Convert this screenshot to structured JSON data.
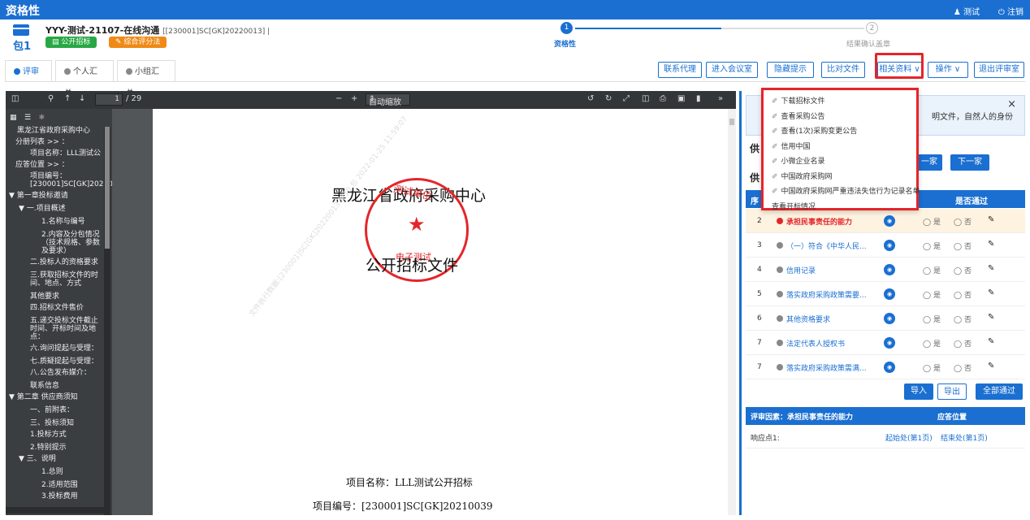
{
  "topbar": {
    "title": "资格性",
    "user": "测试",
    "logout": "注销"
  },
  "header": {
    "package_label": "包1",
    "project_name": "YYY-测试-21107-在线沟通",
    "project_code": "[230001]SC[GK]20220013",
    "tag_public": "公开招标",
    "tag_method": "综合评分法",
    "step1_num": "1",
    "step1_label": "资格性",
    "step2_num": "2",
    "step2_label": "结果确认盖章"
  },
  "tabs": [
    {
      "label": "评审"
    },
    {
      "label": "个人汇总"
    },
    {
      "label": "小组汇总"
    }
  ],
  "toolbar": {
    "contact_agent": "联系代理",
    "enter_meeting": "进入会议室",
    "hide_tip": "隐藏提示",
    "compare_files": "比对文件",
    "related_docs": "相关资料 ∨",
    "operation": "操作 ∨",
    "exit_review": "退出评审室"
  },
  "pdf": {
    "page_input": "1",
    "page_total": "/ 29",
    "zoom": "自动缩放",
    "title_line1": "黑龙江省政府采购中心",
    "title_line2": "公开招标文件",
    "seal_top": "测试单位",
    "seal_bottom": "电子测试",
    "project_name_line": "项目名称：LLL测试公开招标",
    "project_code_line": "项目编号：[230001]SC[GK]20210039",
    "watermark": "文件执行数据:[230001]SC[GK]20220013 第10 包 2022-01-25 11:59:07"
  },
  "outline": [
    "黑龙江省政府采购中心",
    "分册列表 >> ：",
    "项目名称：LLL测试公",
    "应答位置 >> ：",
    "项目编号：",
    "[230001]SC[GK]202100",
    "▼ 第一章投标邀请",
    "▼ 一.项目概述",
    "1.名称与编号",
    "2.内容及分包情况",
    "（技术规格、参数",
    "及要求）",
    "二.投标人的资格要求",
    "三.获取招标文件的时",
    "间、地点、方式",
    "其他要求",
    "四.招标文件售价",
    "五.递交投标文件截止",
    "时间、开标时间及地",
    "点：",
    "六.询问提起与受理：",
    "七.质疑提起与受理：",
    "八.公告发布媒介：",
    "联系信息",
    "▼ 第二章 供应商须知",
    "一、前附表：",
    "三、投标须知",
    "1.投标方式",
    "2.特别提示",
    "▼ 三、说明",
    "1.总则",
    "2.适用范围",
    "3.投标费用"
  ],
  "dropdown": [
    "下载招标文件",
    "查看采购公告",
    "查看(1次)采购变更公告",
    "信用中国",
    "小微企业名录",
    "中国政府采购网",
    "中国政府采购网严重违法失信行为记录名单",
    "查看开标情况"
  ],
  "infobox": {
    "close": "×",
    "text": "明文件，自然人的身份"
  },
  "nav": {
    "prev": "一家",
    "next": "下一家",
    "side1": "供",
    "side2": "供"
  },
  "table": {
    "header_left": "序",
    "header_pass": "是否通过",
    "yes": "是",
    "no": "否",
    "rows": [
      {
        "num": "2",
        "name": "承担民事责任的能力"
      },
      {
        "num": "3",
        "name": "（一）符合《中华人民..."
      },
      {
        "num": "4",
        "name": "信用记录"
      },
      {
        "num": "5",
        "name": "落实政府采购政策需要..."
      },
      {
        "num": "6",
        "name": "其他资格要求"
      },
      {
        "num": "7",
        "name": "法定代表人授权书"
      },
      {
        "num": "7",
        "name": "落实政府采购政策需满..."
      }
    ]
  },
  "actions": {
    "import": "导入",
    "export": "导出",
    "pass_all": "全部通过"
  },
  "factor": {
    "label": "评审因素：承担民事责任的能力",
    "position_header": "应答位置",
    "response_point": "响应点1:",
    "start": "起始处(第1页)",
    "end": "结束处(第1页)"
  },
  "colors": {
    "primary": "#1a6fd1",
    "highlight": "#e4252a"
  }
}
